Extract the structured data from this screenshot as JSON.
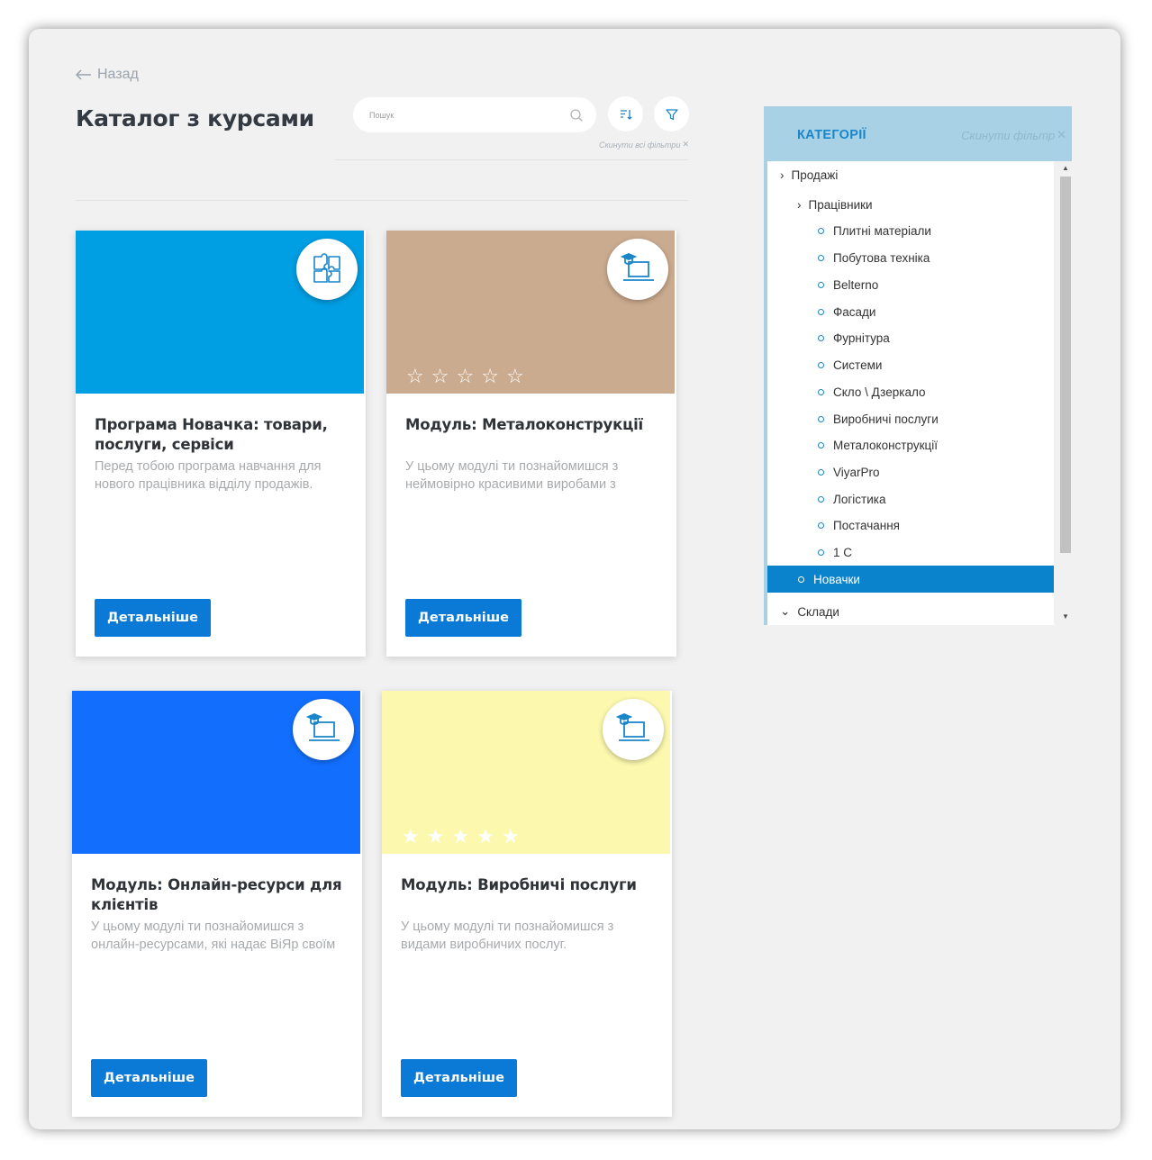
{
  "nav": {
    "back_label": "Назад",
    "back_icon": "arrow-left-icon"
  },
  "page": {
    "title": "Каталог з курсами"
  },
  "search": {
    "placeholder": "Пошук",
    "icon": "search-icon"
  },
  "toolbar": {
    "sort_icon": "sort-icon",
    "filter_icon": "filter-icon",
    "reset_all_label": "Скинути всі фільтри"
  },
  "colors": {
    "accent": "#0b7ad6",
    "category_header": "#a9d1e6",
    "active_category": "#0b83cc",
    "background": "#f1f1f1"
  },
  "courses": [
    {
      "title": "Програма Новачка: товари, послуги, сервіси",
      "description": "Перед тобою програма навчання для нового працівника відділу продажів.",
      "button": "Детальніше",
      "cover_color": "#009ee3",
      "badge_icon": "puzzle-icon",
      "rating_stars": 0,
      "rating_visible": false
    },
    {
      "title": "Модуль: Металоконструкції",
      "description": "У цьому модулі ти познайомишся з неймовірно красивими виробами з",
      "button": "Детальніше",
      "cover_color": "#cbab8f",
      "badge_icon": "laptop-graduation-icon",
      "rating_stars": 0,
      "rating_visible": true
    },
    {
      "title": "Модуль: Онлайн-ресурси для клієнтів",
      "description": "У цьому модулі ти познайомишся з онлайн-ресурсами, які надає ВіЯр своїм",
      "button": "Детальніше",
      "cover_color": "#126ffd",
      "badge_icon": "laptop-graduation-icon",
      "rating_stars": 0,
      "rating_visible": false
    },
    {
      "title": "Модуль: Виробничі послуги",
      "description": "У цьому модулі ти познайомишся з видами виробничих послуг.",
      "button": "Детальніше",
      "cover_color": "#fcf9ae",
      "badge_icon": "laptop-graduation-icon",
      "rating_stars": 5,
      "rating_visible": true
    }
  ],
  "categories": {
    "title": "КАТЕГОРІЇ",
    "reset_label": "Скинути фільтр",
    "items": [
      {
        "label": "Продажі",
        "marker": "›"
      },
      {
        "label": "Працівники",
        "marker": "›"
      },
      {
        "label": "Плитні матеріали",
        "marker": "o"
      },
      {
        "label": "Побутова техніка",
        "marker": "o"
      },
      {
        "label": "Belterno",
        "marker": "o"
      },
      {
        "label": "Фасади",
        "marker": "o"
      },
      {
        "label": "Фурнітура",
        "marker": "o"
      },
      {
        "label": "Системи",
        "marker": "o"
      },
      {
        "label": "Скло \\ Дзеркало",
        "marker": "o"
      },
      {
        "label": "Виробничі послуги",
        "marker": "o"
      },
      {
        "label": "Металоконструкції",
        "marker": "o"
      },
      {
        "label": "ViyarPro",
        "marker": "o"
      },
      {
        "label": "Логістика",
        "marker": "o"
      },
      {
        "label": "Постачання",
        "marker": "o"
      },
      {
        "label": "1 С",
        "marker": "o"
      },
      {
        "label": "Новачки",
        "marker": "o",
        "active": true
      },
      {
        "label": "Склади",
        "marker": "⌄"
      }
    ]
  }
}
